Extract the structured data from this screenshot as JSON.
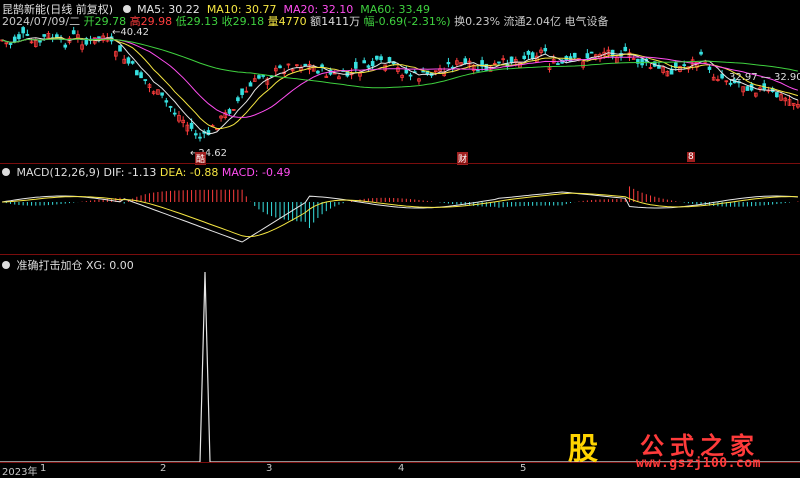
{
  "header": {
    "stock_name": "昆鹄新能(日线 前复权)",
    "ma5": "MA5: 30.22",
    "ma10": "MA10: 30.77",
    "ma20": "MA20: 32.10",
    "ma60": "MA60: 33.49"
  },
  "info_line": {
    "date": "2024/07/09/二",
    "open": "开29.78",
    "high": "高29.98",
    "low": "低29.13",
    "close": "收29.18",
    "volume": "量4770",
    "amount": "额1411万",
    "change": "幅-0.69(-2.31%)",
    "turnover": "换0.23%",
    "float": "流通2.04亿",
    "sector": "电气设备"
  },
  "price_labels": {
    "high_marker": "40.42",
    "low_marker": "24.62",
    "right_low": "32.97",
    "right_high": "32.90"
  },
  "event_markers": {
    "m1": "酷",
    "m2": "财",
    "m3": "8"
  },
  "macd": {
    "title": "MACD(12,26,9)",
    "dif": "DIF: -1.13",
    "dea": "DEA: -0.88",
    "macd_val": "MACD: -0.49"
  },
  "xg": {
    "title": "准确打击加仓",
    "value": "XG: 0.00"
  },
  "x_axis": {
    "year": "2023年",
    "months": [
      "1",
      "2",
      "3",
      "4",
      "5"
    ]
  },
  "watermark": {
    "title": "公式之家",
    "site": "www.gszj100.com",
    "logo": "股"
  },
  "colors": {
    "up": "#ff3d3d",
    "down": "#37e0e0",
    "ma5": "#e6e6e6",
    "ma10": "#f5e642",
    "ma20": "#ff4df0",
    "ma60": "#3fd13f",
    "bg": "#000000"
  }
}
